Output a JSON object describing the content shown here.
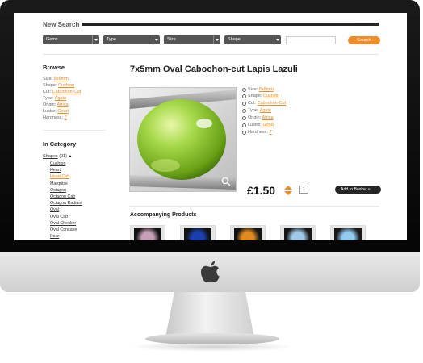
{
  "search": {
    "title": "New Search",
    "filters": [
      "Gems",
      "Type",
      "Size",
      "Shape"
    ],
    "input_value": "",
    "button_label": "Search"
  },
  "sidebar": {
    "browse_heading": "Browse",
    "browse": [
      {
        "key": "Size:",
        "value": "8x6mm"
      },
      {
        "key": "Shape:",
        "value": "Cushion"
      },
      {
        "key": "Cut:",
        "value": "Cabochon-Cut"
      },
      {
        "key": "Type:",
        "value": "Agate"
      },
      {
        "key": "Origin:",
        "value": "Africa"
      },
      {
        "key": "Lustre:",
        "value": "Good"
      },
      {
        "key": "Hardness:",
        "value": "7"
      }
    ],
    "category_heading": "In Category",
    "category_group": {
      "label": "Shapes",
      "count": "(21)",
      "arrow": "▲"
    },
    "categories": [
      "Cushion",
      "Heart",
      "Heart Cab",
      "Marquise",
      "Octagon",
      "Octagon Cab",
      "Octagon Radiant",
      "Oval",
      "Oval Cab",
      "Oval Checker",
      "Oval Concave",
      "Pear"
    ],
    "highlighted_category_index": 2
  },
  "product": {
    "title": "7x5mm Oval Cabochon-cut Lapis Lazuli",
    "specs": [
      {
        "key": "Size:",
        "value": "8x6mm"
      },
      {
        "key": "Shape:",
        "value": "Cushion"
      },
      {
        "key": "Cut:",
        "value": "Cabochon-Cut"
      },
      {
        "key": "Type:",
        "value": "Agate"
      },
      {
        "key": "Origin:",
        "value": "Africa"
      },
      {
        "key": "Lustre:",
        "value": "Good"
      },
      {
        "key": "Hardness:",
        "value": "7"
      }
    ],
    "price": "£1.50",
    "quantity": "1",
    "basket_label": "Add to Basket »"
  },
  "accompanying": {
    "title": "Accompanying Products",
    "thumb_colors": [
      "#c7a0b8",
      "#1c3fb0",
      "#e08a20",
      "#9ec8e8",
      "#8ec8f0"
    ]
  },
  "colors": {
    "accent": "#f08a24",
    "gem": "#8cc63f"
  },
  "icons": {
    "apple": "apple-logo-icon",
    "zoom": "magnifier-icon",
    "quantity": "up-down-arrows-icon"
  }
}
